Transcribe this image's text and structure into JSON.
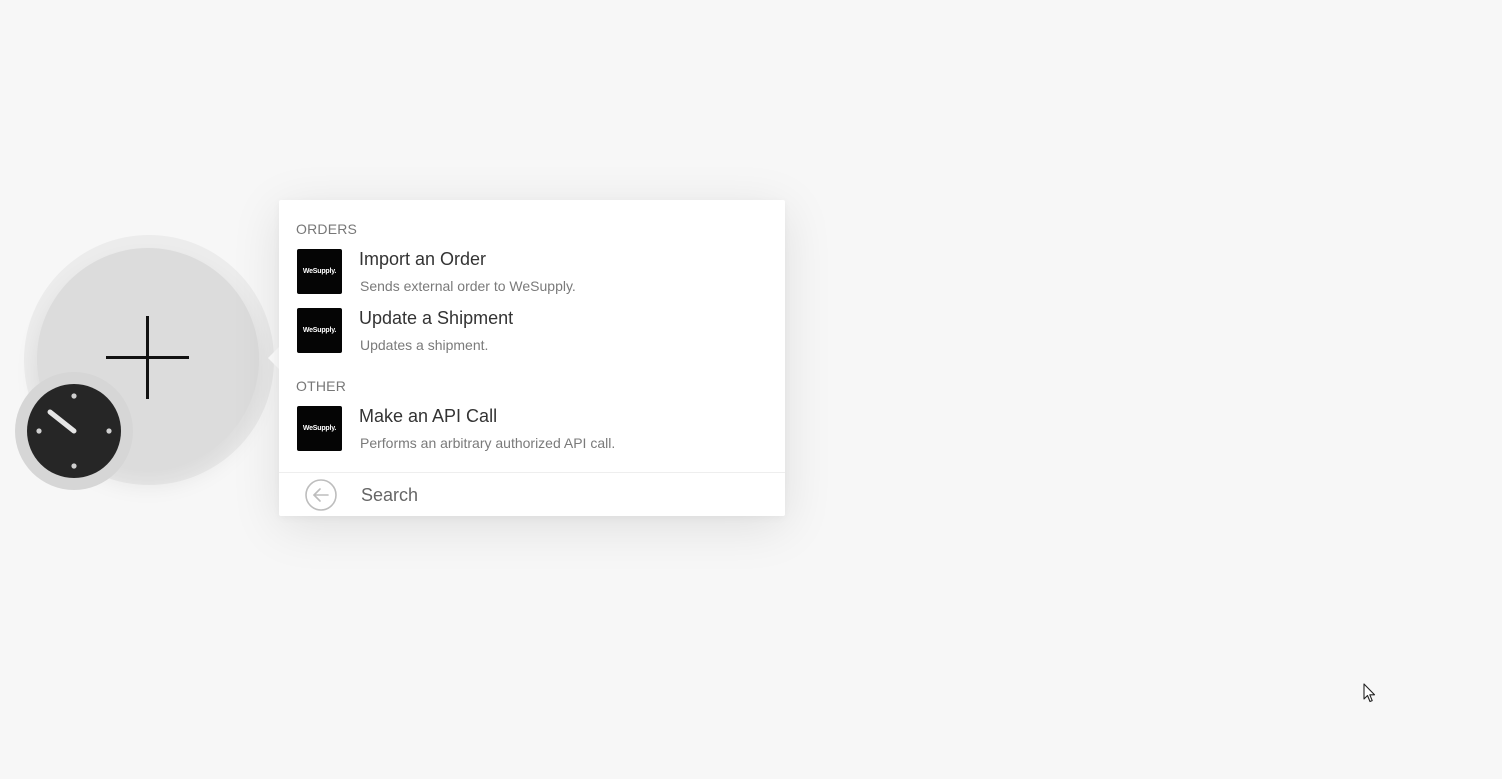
{
  "module": {
    "add_icon": "plus-icon",
    "trigger_icon": "clock-icon"
  },
  "menu": {
    "sections": [
      {
        "header": "ORDERS",
        "items": [
          {
            "title": "Import an Order",
            "description": "Sends external order to WeSupply.",
            "app_logo_text": "WeSupply."
          },
          {
            "title": "Update a Shipment",
            "description": "Updates a shipment.",
            "app_logo_text": "WeSupply."
          }
        ]
      },
      {
        "header": "OTHER",
        "items": [
          {
            "title": "Make an API Call",
            "description": "Performs an arbitrary authorized API call.",
            "app_logo_text": "WeSupply."
          }
        ]
      }
    ],
    "search": {
      "placeholder": "Search",
      "back_icon": "arrow-left-circle-icon"
    }
  },
  "colors": {
    "background": "#f7f7f7",
    "module_circle": "#dcdcdc",
    "app_tile": "#050505",
    "clock_face": "#262626"
  }
}
